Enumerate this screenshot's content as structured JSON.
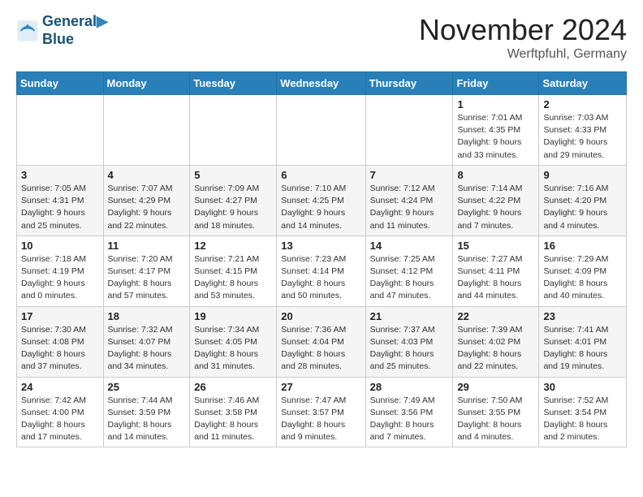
{
  "header": {
    "logo_line1": "General",
    "logo_line2": "Blue",
    "month_title": "November 2024",
    "location": "Werftpfuhl, Germany"
  },
  "days_of_week": [
    "Sunday",
    "Monday",
    "Tuesday",
    "Wednesday",
    "Thursday",
    "Friday",
    "Saturday"
  ],
  "weeks": [
    [
      {
        "day": "",
        "info": ""
      },
      {
        "day": "",
        "info": ""
      },
      {
        "day": "",
        "info": ""
      },
      {
        "day": "",
        "info": ""
      },
      {
        "day": "",
        "info": ""
      },
      {
        "day": "1",
        "info": "Sunrise: 7:01 AM\nSunset: 4:35 PM\nDaylight: 9 hours\nand 33 minutes."
      },
      {
        "day": "2",
        "info": "Sunrise: 7:03 AM\nSunset: 4:33 PM\nDaylight: 9 hours\nand 29 minutes."
      }
    ],
    [
      {
        "day": "3",
        "info": "Sunrise: 7:05 AM\nSunset: 4:31 PM\nDaylight: 9 hours\nand 25 minutes."
      },
      {
        "day": "4",
        "info": "Sunrise: 7:07 AM\nSunset: 4:29 PM\nDaylight: 9 hours\nand 22 minutes."
      },
      {
        "day": "5",
        "info": "Sunrise: 7:09 AM\nSunset: 4:27 PM\nDaylight: 9 hours\nand 18 minutes."
      },
      {
        "day": "6",
        "info": "Sunrise: 7:10 AM\nSunset: 4:25 PM\nDaylight: 9 hours\nand 14 minutes."
      },
      {
        "day": "7",
        "info": "Sunrise: 7:12 AM\nSunset: 4:24 PM\nDaylight: 9 hours\nand 11 minutes."
      },
      {
        "day": "8",
        "info": "Sunrise: 7:14 AM\nSunset: 4:22 PM\nDaylight: 9 hours\nand 7 minutes."
      },
      {
        "day": "9",
        "info": "Sunrise: 7:16 AM\nSunset: 4:20 PM\nDaylight: 9 hours\nand 4 minutes."
      }
    ],
    [
      {
        "day": "10",
        "info": "Sunrise: 7:18 AM\nSunset: 4:19 PM\nDaylight: 9 hours\nand 0 minutes."
      },
      {
        "day": "11",
        "info": "Sunrise: 7:20 AM\nSunset: 4:17 PM\nDaylight: 8 hours\nand 57 minutes."
      },
      {
        "day": "12",
        "info": "Sunrise: 7:21 AM\nSunset: 4:15 PM\nDaylight: 8 hours\nand 53 minutes."
      },
      {
        "day": "13",
        "info": "Sunrise: 7:23 AM\nSunset: 4:14 PM\nDaylight: 8 hours\nand 50 minutes."
      },
      {
        "day": "14",
        "info": "Sunrise: 7:25 AM\nSunset: 4:12 PM\nDaylight: 8 hours\nand 47 minutes."
      },
      {
        "day": "15",
        "info": "Sunrise: 7:27 AM\nSunset: 4:11 PM\nDaylight: 8 hours\nand 44 minutes."
      },
      {
        "day": "16",
        "info": "Sunrise: 7:29 AM\nSunset: 4:09 PM\nDaylight: 8 hours\nand 40 minutes."
      }
    ],
    [
      {
        "day": "17",
        "info": "Sunrise: 7:30 AM\nSunset: 4:08 PM\nDaylight: 8 hours\nand 37 minutes."
      },
      {
        "day": "18",
        "info": "Sunrise: 7:32 AM\nSunset: 4:07 PM\nDaylight: 8 hours\nand 34 minutes."
      },
      {
        "day": "19",
        "info": "Sunrise: 7:34 AM\nSunset: 4:05 PM\nDaylight: 8 hours\nand 31 minutes."
      },
      {
        "day": "20",
        "info": "Sunrise: 7:36 AM\nSunset: 4:04 PM\nDaylight: 8 hours\nand 28 minutes."
      },
      {
        "day": "21",
        "info": "Sunrise: 7:37 AM\nSunset: 4:03 PM\nDaylight: 8 hours\nand 25 minutes."
      },
      {
        "day": "22",
        "info": "Sunrise: 7:39 AM\nSunset: 4:02 PM\nDaylight: 8 hours\nand 22 minutes."
      },
      {
        "day": "23",
        "info": "Sunrise: 7:41 AM\nSunset: 4:01 PM\nDaylight: 8 hours\nand 19 minutes."
      }
    ],
    [
      {
        "day": "24",
        "info": "Sunrise: 7:42 AM\nSunset: 4:00 PM\nDaylight: 8 hours\nand 17 minutes."
      },
      {
        "day": "25",
        "info": "Sunrise: 7:44 AM\nSunset: 3:59 PM\nDaylight: 8 hours\nand 14 minutes."
      },
      {
        "day": "26",
        "info": "Sunrise: 7:46 AM\nSunset: 3:58 PM\nDaylight: 8 hours\nand 11 minutes."
      },
      {
        "day": "27",
        "info": "Sunrise: 7:47 AM\nSunset: 3:57 PM\nDaylight: 8 hours\nand 9 minutes."
      },
      {
        "day": "28",
        "info": "Sunrise: 7:49 AM\nSunset: 3:56 PM\nDaylight: 8 hours\nand 7 minutes."
      },
      {
        "day": "29",
        "info": "Sunrise: 7:50 AM\nSunset: 3:55 PM\nDaylight: 8 hours\nand 4 minutes."
      },
      {
        "day": "30",
        "info": "Sunrise: 7:52 AM\nSunset: 3:54 PM\nDaylight: 8 hours\nand 2 minutes."
      }
    ]
  ]
}
